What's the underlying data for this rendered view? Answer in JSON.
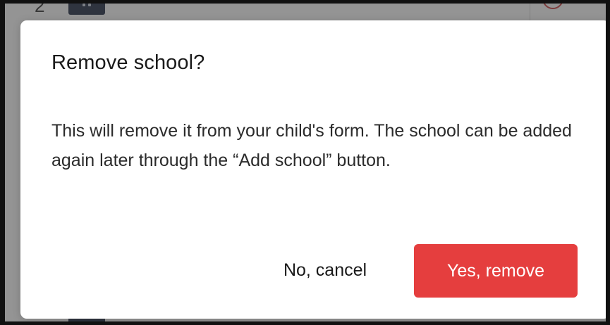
{
  "background": {
    "row_number": "2"
  },
  "modal": {
    "title": "Remove school?",
    "body": "This will remove it from your child's form. The school can be added again later through the “Add school” button.",
    "cancel_label": "No, cancel",
    "confirm_label": "Yes, remove"
  },
  "colors": {
    "confirm_button": "#e53e3e",
    "overlay": "rgba(60,60,60,0.55)",
    "badge": "#1f2a44"
  }
}
